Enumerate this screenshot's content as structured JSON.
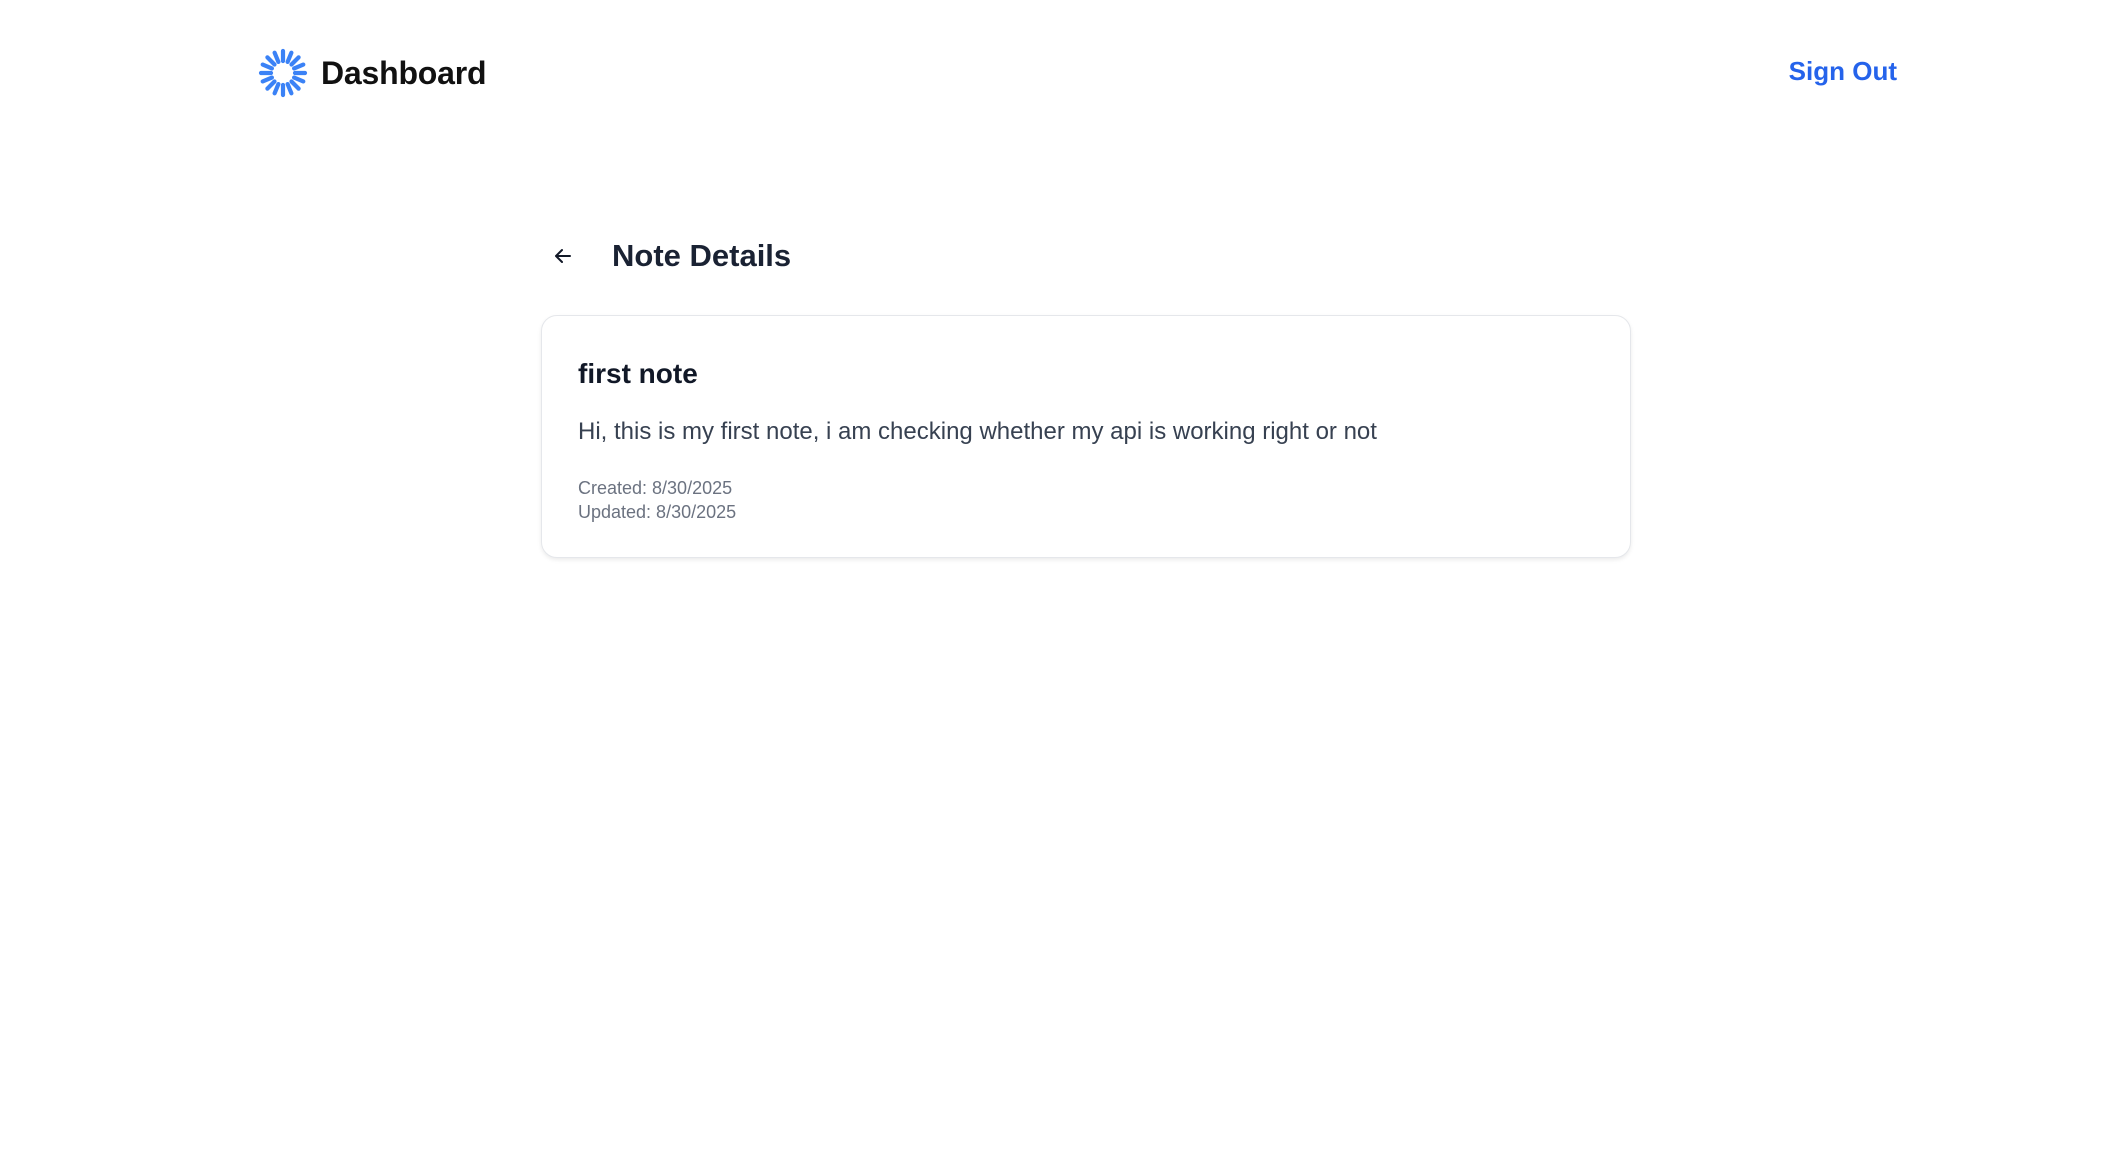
{
  "header": {
    "logo_icon": "loader-sunburst-icon",
    "title": "Dashboard",
    "sign_out_label": "Sign Out",
    "accent_color": "#2563eb",
    "logo_color": "#3b82f6"
  },
  "page": {
    "back_icon": "arrow-left-icon",
    "title": "Note Details"
  },
  "note": {
    "title": "first note",
    "content": "Hi, this is my first note, i am checking whether my api is working right or not",
    "created_label": "Created: 8/30/2025",
    "updated_label": "Updated: 8/30/2025"
  }
}
